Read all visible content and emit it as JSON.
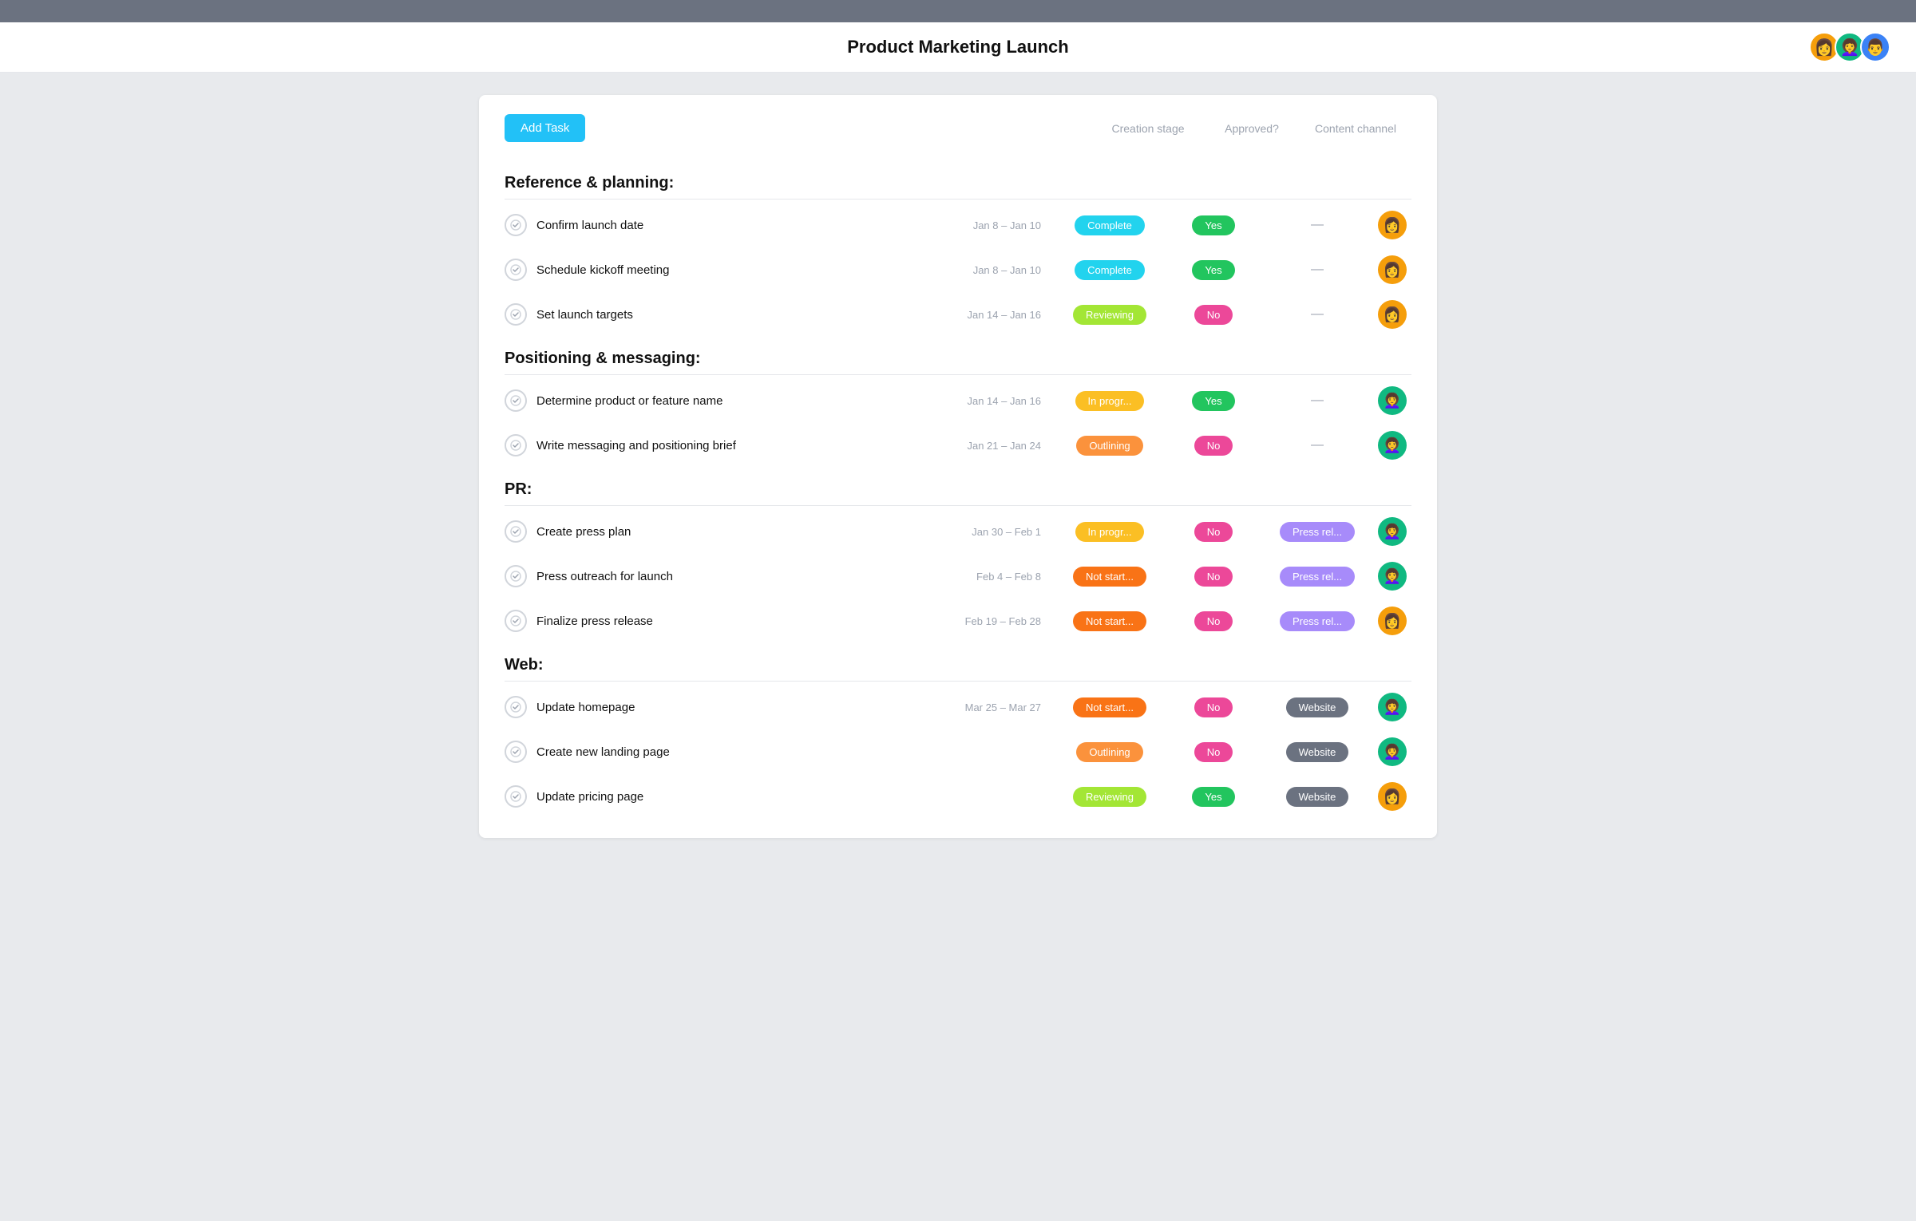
{
  "appHeader": {
    "topBar": "",
    "title": "Product Marketing Launch",
    "avatars": [
      {
        "id": "avatar-1",
        "emoji": "👩",
        "bg": "#f59e0b"
      },
      {
        "id": "avatar-2",
        "emoji": "👩‍🦱",
        "bg": "#10b981"
      },
      {
        "id": "avatar-3",
        "emoji": "👨",
        "bg": "#3b82f6"
      }
    ]
  },
  "toolbar": {
    "addTaskLabel": "Add Task",
    "columns": [
      {
        "id": "creation-stage",
        "label": "Creation stage"
      },
      {
        "id": "approved",
        "label": "Approved?"
      },
      {
        "id": "content-channel",
        "label": "Content channel"
      }
    ]
  },
  "sections": [
    {
      "id": "reference-planning",
      "title": "Reference & planning:",
      "tasks": [
        {
          "id": "task-1",
          "name": "Confirm launch date",
          "dates": "Jan 8 – Jan 10",
          "stage": "Complete",
          "stageBadge": "complete",
          "approved": "Yes",
          "approvedBadge": "yes",
          "channel": "—",
          "channelBadge": "dash",
          "assigneeEmoji": "👩",
          "assigneeBg": "#f59e0b"
        },
        {
          "id": "task-2",
          "name": "Schedule kickoff meeting",
          "dates": "Jan 8 – Jan 10",
          "stage": "Complete",
          "stageBadge": "complete",
          "approved": "Yes",
          "approvedBadge": "yes",
          "channel": "—",
          "channelBadge": "dash",
          "assigneeEmoji": "👩",
          "assigneeBg": "#f59e0b"
        },
        {
          "id": "task-3",
          "name": "Set launch targets",
          "dates": "Jan 14 – Jan 16",
          "stage": "Reviewing",
          "stageBadge": "reviewing",
          "approved": "No",
          "approvedBadge": "no",
          "channel": "—",
          "channelBadge": "dash",
          "assigneeEmoji": "👩",
          "assigneeBg": "#f59e0b"
        }
      ]
    },
    {
      "id": "positioning-messaging",
      "title": "Positioning & messaging:",
      "tasks": [
        {
          "id": "task-4",
          "name": "Determine product or feature name",
          "dates": "Jan 14 – Jan 16",
          "stage": "In progr...",
          "stageBadge": "inprogress",
          "approved": "Yes",
          "approvedBadge": "yes",
          "channel": "—",
          "channelBadge": "dash",
          "assigneeEmoji": "👩‍🦱",
          "assigneeBg": "#10b981"
        },
        {
          "id": "task-5",
          "name": "Write messaging and positioning brief",
          "dates": "Jan 21 – Jan 24",
          "stage": "Outlining",
          "stageBadge": "outlining",
          "approved": "No",
          "approvedBadge": "no",
          "channel": "—",
          "channelBadge": "dash",
          "assigneeEmoji": "👩‍🦱",
          "assigneeBg": "#10b981"
        }
      ]
    },
    {
      "id": "pr",
      "title": "PR:",
      "tasks": [
        {
          "id": "task-6",
          "name": "Create press plan",
          "dates": "Jan 30 – Feb 1",
          "stage": "In progr...",
          "stageBadge": "inprogress",
          "approved": "No",
          "approvedBadge": "no",
          "channel": "Press rel...",
          "channelBadge": "pressrel",
          "assigneeEmoji": "👩‍🦱",
          "assigneeBg": "#10b981"
        },
        {
          "id": "task-7",
          "name": "Press outreach for launch",
          "dates": "Feb 4 – Feb 8",
          "stage": "Not start...",
          "stageBadge": "notstart",
          "approved": "No",
          "approvedBadge": "no",
          "channel": "Press rel...",
          "channelBadge": "pressrel",
          "assigneeEmoji": "👩‍🦱",
          "assigneeBg": "#10b981"
        },
        {
          "id": "task-8",
          "name": "Finalize press release",
          "dates": "Feb 19 – Feb 28",
          "stage": "Not start...",
          "stageBadge": "notstart",
          "approved": "No",
          "approvedBadge": "no",
          "channel": "Press rel...",
          "channelBadge": "pressrel",
          "assigneeEmoji": "👩",
          "assigneeBg": "#f59e0b"
        }
      ]
    },
    {
      "id": "web",
      "title": "Web:",
      "tasks": [
        {
          "id": "task-9",
          "name": "Update homepage",
          "dates": "Mar 25 – Mar 27",
          "stage": "Not start...",
          "stageBadge": "notstart",
          "approved": "No",
          "approvedBadge": "no",
          "channel": "Website",
          "channelBadge": "website",
          "assigneeEmoji": "👩‍🦱",
          "assigneeBg": "#10b981"
        },
        {
          "id": "task-10",
          "name": "Create new landing page",
          "dates": "",
          "stage": "Outlining",
          "stageBadge": "outlining",
          "approved": "No",
          "approvedBadge": "no",
          "channel": "Website",
          "channelBadge": "website",
          "assigneeEmoji": "👩‍🦱",
          "assigneeBg": "#10b981"
        },
        {
          "id": "task-11",
          "name": "Update pricing page",
          "dates": "",
          "stage": "Reviewing",
          "stageBadge": "reviewing",
          "approved": "Yes",
          "approvedBadge": "yes",
          "channel": "Website",
          "channelBadge": "website",
          "assigneeEmoji": "👩",
          "assigneeBg": "#f59e0b"
        }
      ]
    }
  ]
}
